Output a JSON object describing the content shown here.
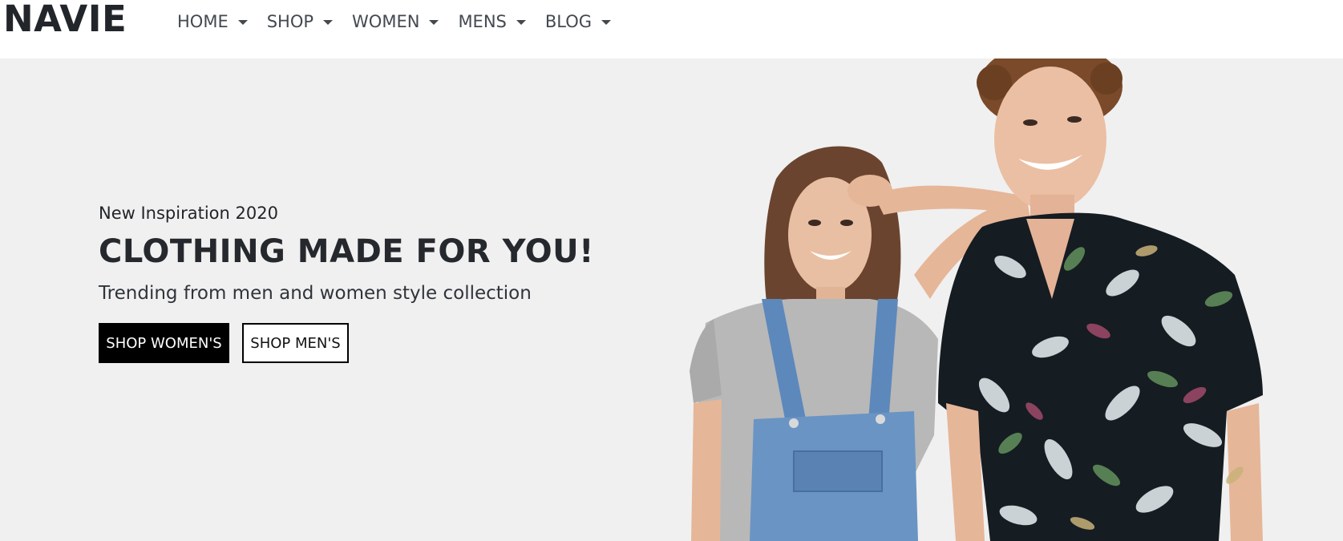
{
  "brand": {
    "logo": "NAVIE"
  },
  "nav": {
    "items": [
      {
        "label": "HOME",
        "icon": "caret-down-icon"
      },
      {
        "label": "SHOP",
        "icon": "caret-down-icon"
      },
      {
        "label": "WOMEN",
        "icon": "caret-down-icon"
      },
      {
        "label": "MENS",
        "icon": "caret-down-icon"
      },
      {
        "label": "BLOG",
        "icon": "caret-down-icon"
      }
    ]
  },
  "hero": {
    "subtitle": "New Inspiration 2020",
    "headline": "CLOTHING MADE FOR YOU!",
    "tagline": "Trending from men and women style collection",
    "primary_button": "SHOP WOMEN'S",
    "secondary_button": "SHOP MEN'S",
    "image": "hero-models-image"
  },
  "colors": {
    "hero_background": "#f0f0f0",
    "primary_button_bg": "#000000",
    "text": "#222529"
  }
}
